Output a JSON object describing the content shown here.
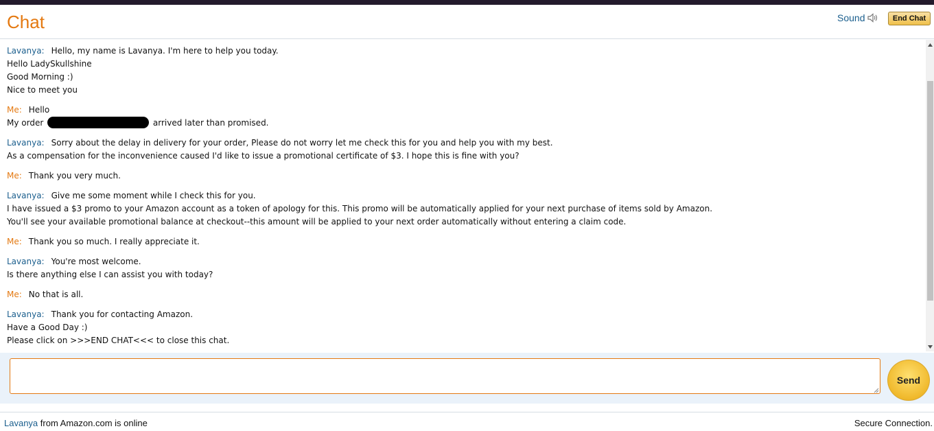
{
  "header": {
    "title": "Chat",
    "sound_label": "Sound",
    "sound_icon": "speaker-icon",
    "end_chat_label": "End Chat"
  },
  "transcript": {
    "messages": [
      {
        "speaker": "Lavanya:",
        "role": "agent",
        "lines": [
          "Hello, my name is Lavanya. I'm here to help you today.",
          "Hello LadySkullshine",
          "Good Morning :)",
          "Nice to meet you"
        ]
      },
      {
        "speaker": "Me:",
        "role": "me",
        "lines": [
          "Hello"
        ],
        "order_line": {
          "before": "My order ",
          "after": " arrived later than promised."
        }
      },
      {
        "speaker": "Lavanya:",
        "role": "agent",
        "lines": [
          "Sorry about the delay in delivery for your order, Please do not worry let me check this for you and help you with my best.",
          "As a compensation for the inconvenience caused I'd like to issue a promotional certificate of $3. I hope this is fine with you?"
        ]
      },
      {
        "speaker": "Me:",
        "role": "me",
        "lines": [
          "Thank you very much."
        ]
      },
      {
        "speaker": "Lavanya:",
        "role": "agent",
        "lines": [
          "Give me some moment while I check this for you.",
          "I have issued a $3 promo to your Amazon account as a token of apology for this. This promo will be automatically applied for your next purchase of items sold by Amazon.",
          "You'll see your available promotional balance at checkout--this amount will be applied to your next order automatically without entering a claim code."
        ]
      },
      {
        "speaker": "Me:",
        "role": "me",
        "lines": [
          "Thank you so much. I really appreciate it."
        ]
      },
      {
        "speaker": "Lavanya:",
        "role": "agent",
        "lines": [
          "You're most welcome.",
          "Is there anything else I can assist you with today?"
        ]
      },
      {
        "speaker": "Me:",
        "role": "me",
        "lines": [
          "No that is all."
        ]
      },
      {
        "speaker": "Lavanya:",
        "role": "agent",
        "lines": [
          "Thank you for contacting Amazon.",
          "Have a Good Day :)",
          "Please click on >>>END CHAT<<< to close this chat."
        ]
      }
    ]
  },
  "composer": {
    "input_value": "",
    "send_label": "Send"
  },
  "footer": {
    "agent_name": "Lavanya",
    "status_text": " from Amazon.com is online",
    "secure_text": "Secure Connection."
  },
  "colors": {
    "accent_orange": "#e47911",
    "link_blue": "#1a5e8d",
    "button_gold": "#f0c14b"
  }
}
